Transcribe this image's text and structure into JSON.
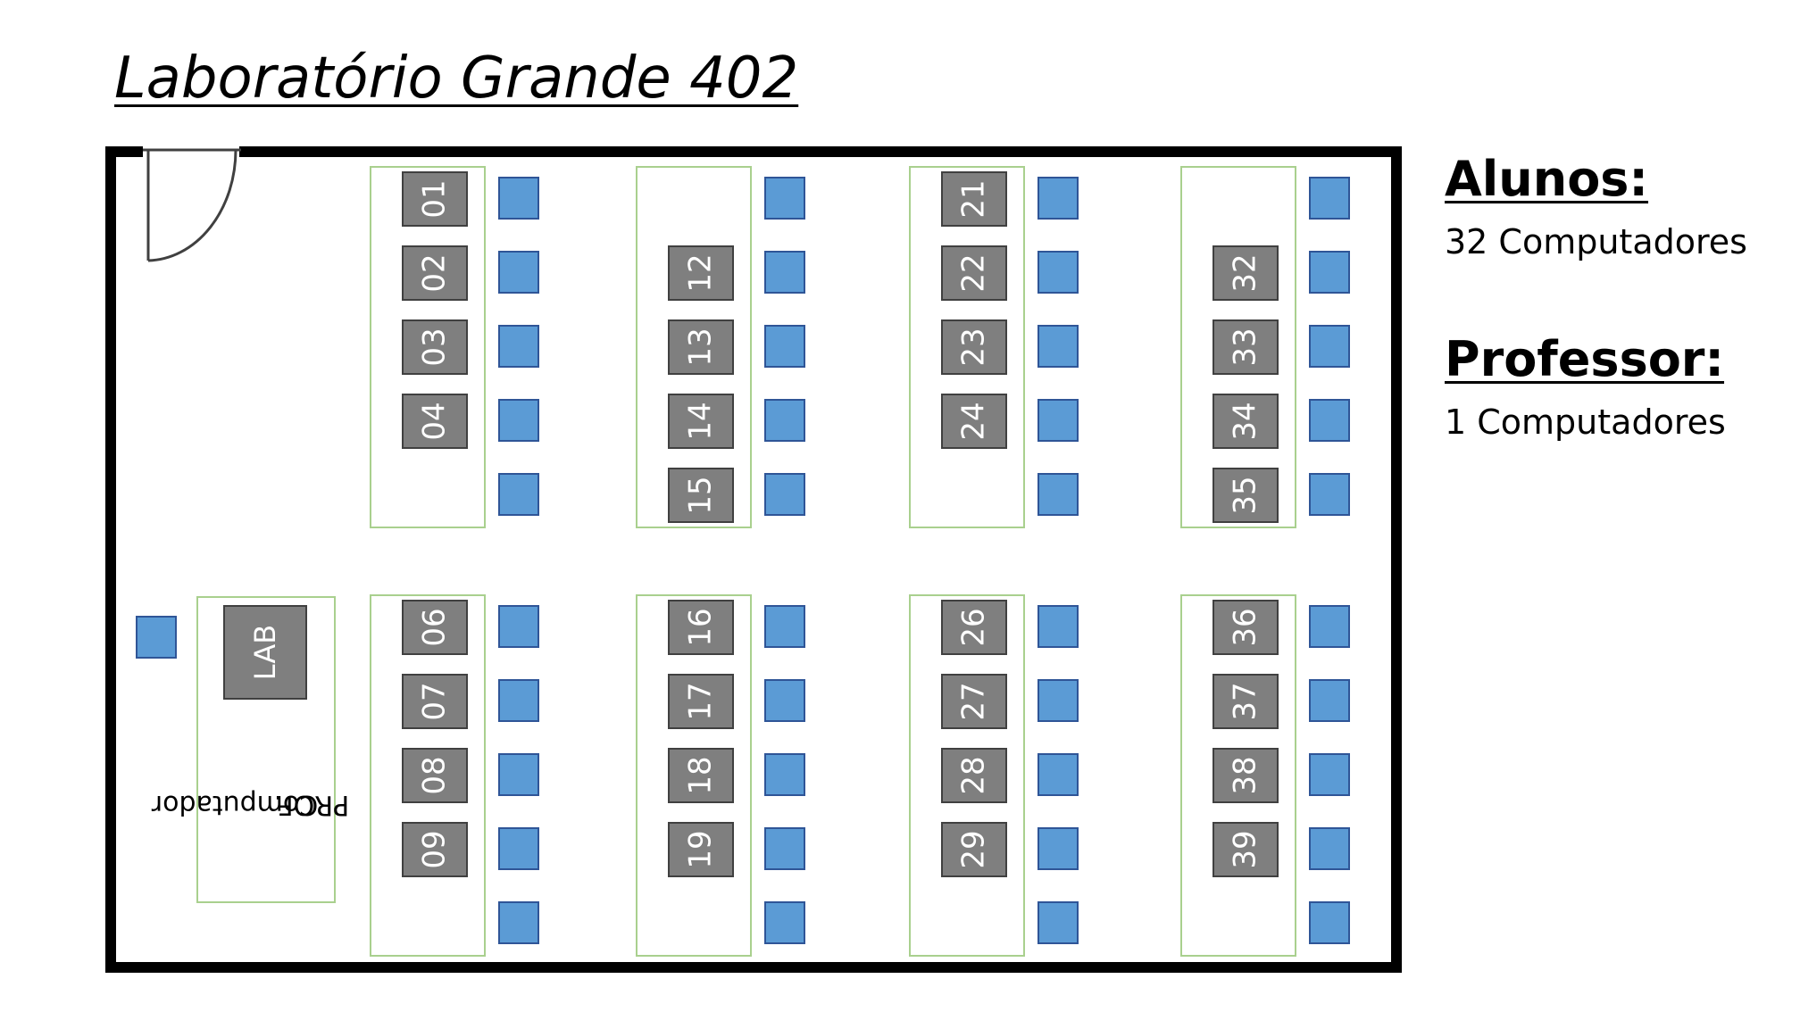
{
  "title": "Laboratório Grande 402",
  "legend": {
    "students_heading": "Alunos:",
    "students_value": "32 Computadores",
    "teacher_heading": "Professor:",
    "teacher_value": "1 Computadores"
  },
  "teacher_station": {
    "pc_label": "LAB",
    "caption_line1": "Computador",
    "caption_line2": "PROF."
  },
  "columns": [
    {
      "top_numbers": [
        "01",
        "02",
        "03",
        "04"
      ],
      "bottom_numbers": [
        "06",
        "07",
        "08",
        "09"
      ]
    },
    {
      "top_numbers": [
        "12",
        "13",
        "14",
        "15"
      ],
      "bottom_numbers": [
        "16",
        "17",
        "18",
        "19"
      ]
    },
    {
      "top_numbers": [
        "21",
        "22",
        "23",
        "24"
      ],
      "bottom_numbers": [
        "26",
        "27",
        "28",
        "29"
      ]
    },
    {
      "top_numbers": [
        "32",
        "33",
        "34",
        "35"
      ],
      "bottom_numbers": [
        "36",
        "37",
        "38",
        "39"
      ]
    }
  ],
  "colors": {
    "computer": "#7f7f7f",
    "chair": "#5b9bd5",
    "table_outline": "#a9d08e",
    "wall": "#000000"
  }
}
